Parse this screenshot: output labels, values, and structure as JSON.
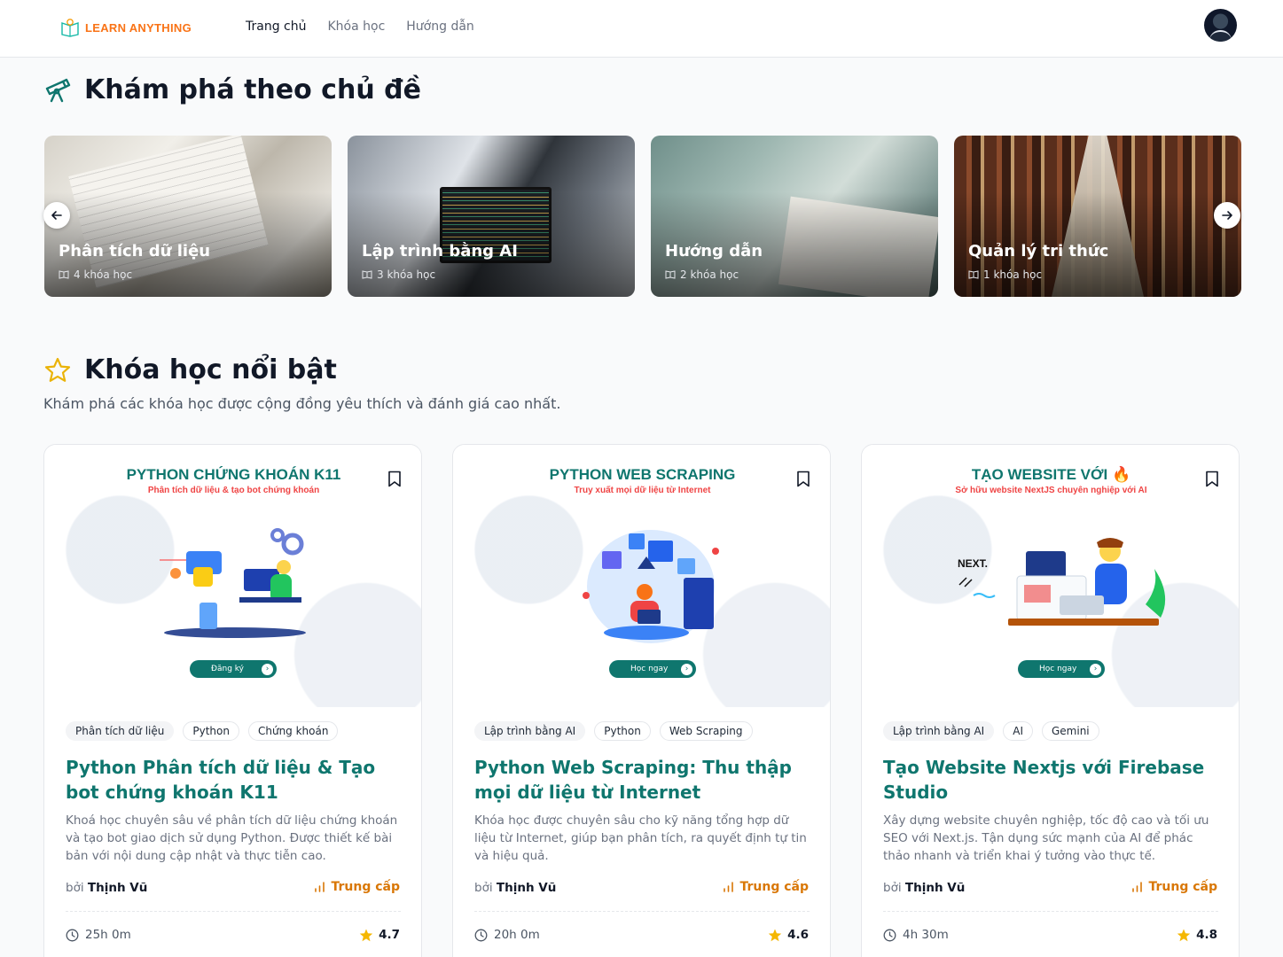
{
  "header": {
    "logo": "LEARN ANYTHING",
    "nav": [
      {
        "label": "Trang chủ",
        "active": true
      },
      {
        "label": "Khóa học",
        "active": false
      },
      {
        "label": "Hướng dẫn",
        "active": false
      }
    ]
  },
  "topics_section": {
    "title": "Khám phá theo chủ đề",
    "topics": [
      {
        "name": "Phân tích dữ liệu",
        "count": "4 khóa học"
      },
      {
        "name": "Lập trình bằng AI",
        "count": "3 khóa học"
      },
      {
        "name": "Hướng dẫn",
        "count": "2 khóa học"
      },
      {
        "name": "Quản lý tri thức",
        "count": "1 khóa học"
      }
    ]
  },
  "featured_section": {
    "title": "Khóa học nổi bật",
    "subtitle": "Khám phá các khóa học được cộng đồng yêu thích và đánh giá cao nhất."
  },
  "courses": [
    {
      "thumb_title": "PYTHON CHỨNG KHOÁN K11",
      "thumb_subtitle": "Phân tích dữ liệu & tạo bot chứng khoán",
      "thumb_cta": "Đăng ký",
      "tags": [
        "Phân tích dữ liệu",
        "Python",
        "Chứng khoán"
      ],
      "title": "Python Phân tích dữ liệu & Tạo bot chứng khoán K11",
      "description": "Khoá học chuyên sâu về phân tích dữ liệu chứng khoán và tạo bot giao dịch sử dụng Python. Được thiết kế bài bản với nội dung cập nhật và thực tiễn cao.",
      "author_prefix": "bởi",
      "author": "Thịnh Vũ",
      "level": "Trung cấp",
      "duration": "25h 0m",
      "rating": "4.7"
    },
    {
      "thumb_title": "PYTHON WEB SCRAPING",
      "thumb_subtitle": "Truy xuất mọi dữ liệu từ Internet",
      "thumb_cta": "Học ngay",
      "tags": [
        "Lập trình bằng AI",
        "Python",
        "Web Scraping"
      ],
      "title": "Python Web Scraping: Thu thập mọi dữ liệu từ Internet",
      "description": "Khóa học được chuyên sâu cho kỹ năng tổng hợp dữ liệu từ Internet, giúp bạn phân tích, ra quyết định tự tin và hiệu quả.",
      "author_prefix": "bởi",
      "author": "Thịnh Vũ",
      "level": "Trung cấp",
      "duration": "20h 0m",
      "rating": "4.6"
    },
    {
      "thumb_title": "TẠO WEBSITE VỚI",
      "thumb_subtitle": "Sở hữu website NextJS chuyên nghiệp với AI",
      "thumb_cta": "Học ngay",
      "tags": [
        "Lập trình bằng AI",
        "AI",
        "Gemini"
      ],
      "title": "Tạo Website Nextjs với Firebase Studio",
      "description": "Xây dựng website chuyên nghiệp, tốc độ cao và tối ưu SEO với Next.js. Tận dụng sức mạnh của AI để phác thảo nhanh và triển khai ý tưởng vào thực tế.",
      "author_prefix": "bởi",
      "author": "Thịnh Vũ",
      "level": "Trung cấp",
      "duration": "4h 30m",
      "rating": "4.8"
    }
  ],
  "colors": {
    "brand_orange": "#f97316",
    "primary_teal": "#0f766e",
    "level_amber": "#d97706",
    "star_gold": "#f5b700"
  },
  "icons": {
    "logo": "book-bulb-icon",
    "topics_heading": "telescope-icon",
    "featured_heading": "star-outline-icon",
    "topic_count": "open-book-icon",
    "bookmark": "bookmark-icon",
    "level": "bar-chart-icon",
    "duration": "clock-icon",
    "rating": "star-filled-icon",
    "carousel_prev": "arrow-left-icon",
    "carousel_next": "arrow-right-icon"
  }
}
